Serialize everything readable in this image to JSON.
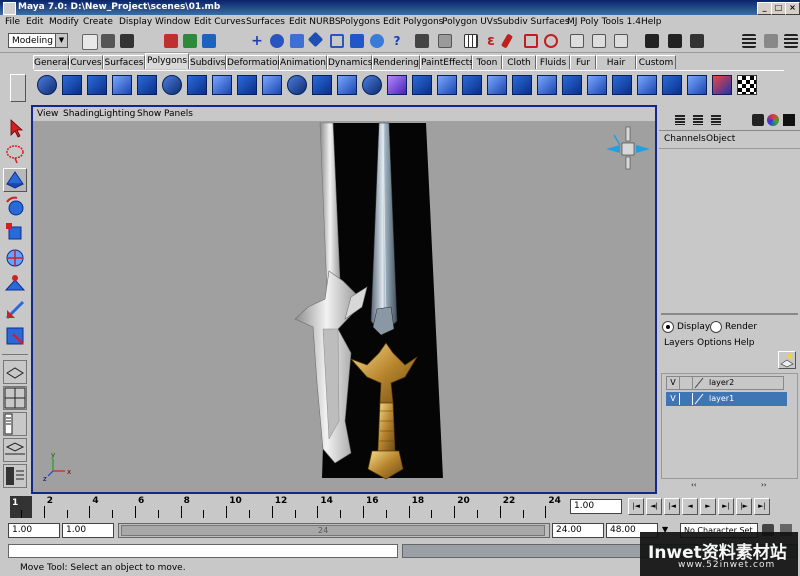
{
  "window": {
    "title": "Maya 7.0: D:\\New_Project\\scenes\\01.mb",
    "minimize_label": "_",
    "maximize_label": "□",
    "close_label": "×"
  },
  "menubar": [
    "File",
    "Edit",
    "Modify",
    "Create",
    "Display",
    "Window",
    "Edit Curves",
    "Surfaces",
    "Edit NURBS",
    "Polygons",
    "Edit Polygons",
    "Polygon UVs",
    "Subdiv Surfaces",
    "MJ Poly Tools 1.4",
    "Help"
  ],
  "status_line": {
    "mode": "Modeling"
  },
  "shelf_tabs": [
    "General",
    "Curves",
    "Surfaces",
    "Polygons",
    "Subdivs",
    "Deformation",
    "Animation",
    "Dynamics",
    "Rendering",
    "PaintEffects",
    "Toon",
    "Cloth",
    "Fluids",
    "Fur",
    "Hair",
    "Custom"
  ],
  "active_shelf_tab": "Polygons",
  "viewport": {
    "menu": [
      "View",
      "Shading",
      "Lighting",
      "Show",
      "Panels"
    ],
    "axis_x": "x",
    "axis_y": "y",
    "axis_z": "z"
  },
  "channel_box": {
    "menu": [
      "Channels",
      "Object"
    ]
  },
  "layer_editor": {
    "display_label": "Display",
    "render_label": "Render",
    "menu": [
      "Layers",
      "Options",
      "Help"
    ],
    "layers": [
      {
        "visible": "V",
        "name": "layer2",
        "selected": false
      },
      {
        "visible": "V",
        "name": "layer1",
        "selected": true
      }
    ]
  },
  "time_slider": {
    "ticks": [
      "2",
      "4",
      "6",
      "8",
      "10",
      "12",
      "14",
      "16",
      "18",
      "20",
      "22",
      "24"
    ],
    "current_frame": "1",
    "current_time": "1.00"
  },
  "range_slider": {
    "start_time": "1.00",
    "playback_start": "1.00",
    "range_label": "24",
    "playback_end": "24.00",
    "end_time": "48.00",
    "character_set": "No Character Set"
  },
  "help_line": "Move Tool: Select an object to move.",
  "watermark": {
    "text": "Inwet资料素材站",
    "url": "www.52inwet.com"
  },
  "colors": {
    "title_bar": "#0a246a",
    "selection": "#3f75b5",
    "viewport_bg": "#a0a0a0",
    "active_panel_border": "#14288a"
  }
}
